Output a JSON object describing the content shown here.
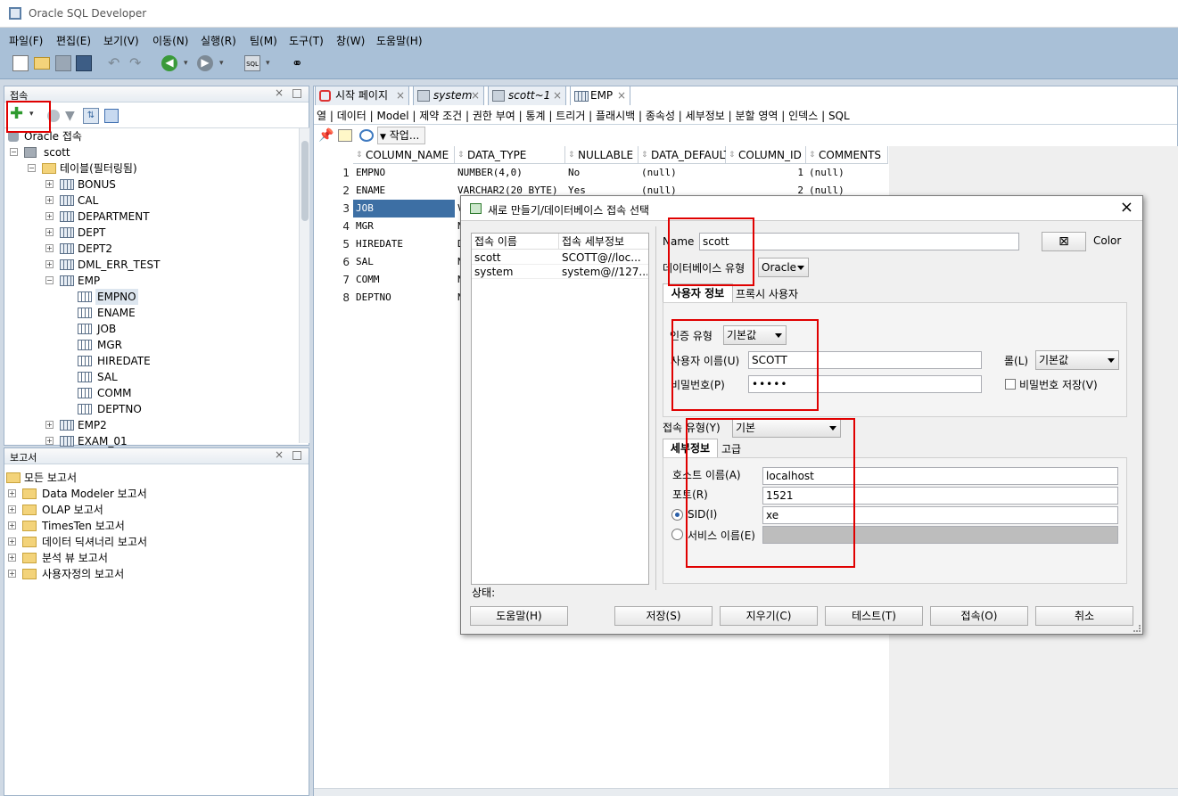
{
  "window": {
    "title": "Oracle SQL Developer"
  },
  "menu": [
    "파일(F)",
    "편집(E)",
    "보기(V)",
    "이동(N)",
    "실행(R)",
    "팀(M)",
    "도구(T)",
    "창(W)",
    "도움말(H)"
  ],
  "connections_panel": {
    "title": "접속",
    "root": "Oracle 접속",
    "conn": "scott",
    "tables_folder": "테이블(필터링됨)",
    "tables": [
      "BONUS",
      "CAL",
      "DEPARTMENT",
      "DEPT",
      "DEPT2",
      "DML_ERR_TEST",
      "EMP"
    ],
    "emp_columns": [
      "EMPNO",
      "ENAME",
      "JOB",
      "MGR",
      "HIREDATE",
      "SAL",
      "COMM",
      "DEPTNO"
    ],
    "more_tables": [
      "EMP2",
      "EXAM_01"
    ]
  },
  "reports_panel": {
    "title": "보고서",
    "items": [
      "모든 보고서",
      "Data Modeler 보고서",
      "OLAP 보고서",
      "TimesTen 보고서",
      "데이터 딕셔너리 보고서",
      "분석 뷰 보고서",
      "사용자정의 보고서"
    ]
  },
  "editor_tabs": [
    "시작 페이지",
    "system",
    "scott~1",
    "EMP"
  ],
  "subtabs": "열 | 데이터 | Model | 제약 조건 | 권한 부여 | 통계 | 트리거 | 플래시백 | 종속성 | 세부정보 | 분할 영역 | 인덱스 | SQL",
  "actions_label": "작업...",
  "grid": {
    "headers": [
      "COLUMN_NAME",
      "DATA_TYPE",
      "NULLABLE",
      "DATA_DEFAULT",
      "COLUMN_ID",
      "COMMENTS"
    ],
    "rows": [
      {
        "n": "1",
        "name": "EMPNO",
        "type": "NUMBER(4,0)",
        "nullable": "No",
        "def": "(null)",
        "id": "1",
        "comments": "(null)"
      },
      {
        "n": "2",
        "name": "ENAME",
        "type": "VARCHAR2(20 BYTE)",
        "nullable": "Yes",
        "def": "(null)",
        "id": "2",
        "comments": "(null)"
      },
      {
        "n": "3",
        "name": "JOB",
        "type": "V"
      },
      {
        "n": "4",
        "name": "MGR",
        "type": "N"
      },
      {
        "n": "5",
        "name": "HIREDATE",
        "type": "D"
      },
      {
        "n": "6",
        "name": "SAL",
        "type": "N"
      },
      {
        "n": "7",
        "name": "COMM",
        "type": "N"
      },
      {
        "n": "8",
        "name": "DEPTNO",
        "type": "N"
      }
    ]
  },
  "dialog": {
    "title": "새로 만들기/데이터베이스 접속 선택",
    "list_headers": [
      "접속 이름",
      "접속 세부정보"
    ],
    "list_rows": [
      [
        "scott",
        "SCOTT@//loc..."
      ],
      [
        "system",
        "system@//127...."
      ]
    ],
    "name_label": "Name",
    "name_value": "scott",
    "color_label": "Color",
    "dbtype_label": "데이터베이스 유형",
    "dbtype_value": "Oracle",
    "tab_user": "사용자 정보",
    "tab_proxy": "프록시 사용자",
    "auth_label": "인증 유형",
    "auth_value": "기본값",
    "user_label": "사용자 이름(U)",
    "user_value": "SCOTT",
    "role_label": "롤(L)",
    "role_value": "기본값",
    "pw_label": "비밀번호(P)",
    "pw_value": "•••••",
    "save_pw_label": "비밀번호 저장(V)",
    "conn_type_label": "접속 유형(Y)",
    "conn_type_value": "기본",
    "tab_details": "세부정보",
    "tab_advanced": "고급",
    "host_label": "호스트 이름(A)",
    "host_value": "localhost",
    "port_label": "포트(R)",
    "port_value": "1521",
    "sid_label": "SID(I)",
    "sid_value": "xe",
    "service_label": "서비스 이름(E)",
    "status_label": "상태:",
    "buttons": {
      "help": "도움말(H)",
      "save": "저장(S)",
      "clear": "지우기(C)",
      "test": "테스트(T)",
      "connect": "접속(O)",
      "cancel": "취소"
    }
  }
}
